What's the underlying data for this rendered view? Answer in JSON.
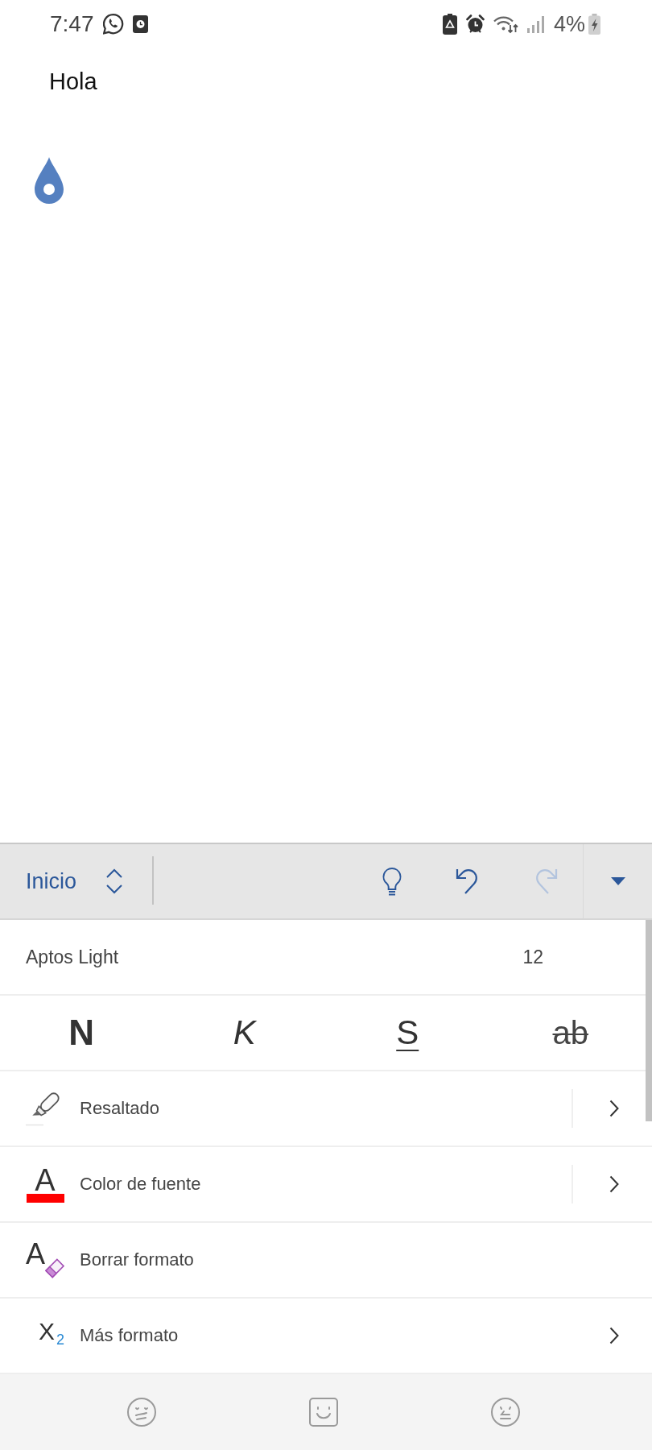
{
  "status_bar": {
    "time": "7:47",
    "battery": "4%"
  },
  "document": {
    "text": "Hola"
  },
  "toolbar": {
    "tab": "Inicio",
    "actions": [
      {
        "kind": "ideas",
        "disabled": false
      },
      {
        "kind": "undo",
        "disabled": false
      },
      {
        "kind": "redo",
        "disabled": true
      }
    ]
  },
  "font": {
    "name": "Aptos Light",
    "size": "12"
  },
  "format_buttons": [
    {
      "label": "N",
      "kind": "bold"
    },
    {
      "label": "K",
      "kind": "italic"
    },
    {
      "label": "S",
      "kind": "underline"
    },
    {
      "label": "ab",
      "kind": "strike"
    }
  ],
  "menu": [
    {
      "label": "Resaltado",
      "kind": "highlight",
      "split": true,
      "submenu": true
    },
    {
      "label": "Color de fuente",
      "kind": "font_color",
      "glyph": "A",
      "split": true,
      "submenu": true
    },
    {
      "label": "Borrar formato",
      "kind": "clear",
      "glyph": "A",
      "split": false,
      "submenu": false
    },
    {
      "label": "Más formato",
      "kind": "more",
      "glyph": "X$_{2}$",
      "split": false,
      "submenu": true
    }
  ]
}
